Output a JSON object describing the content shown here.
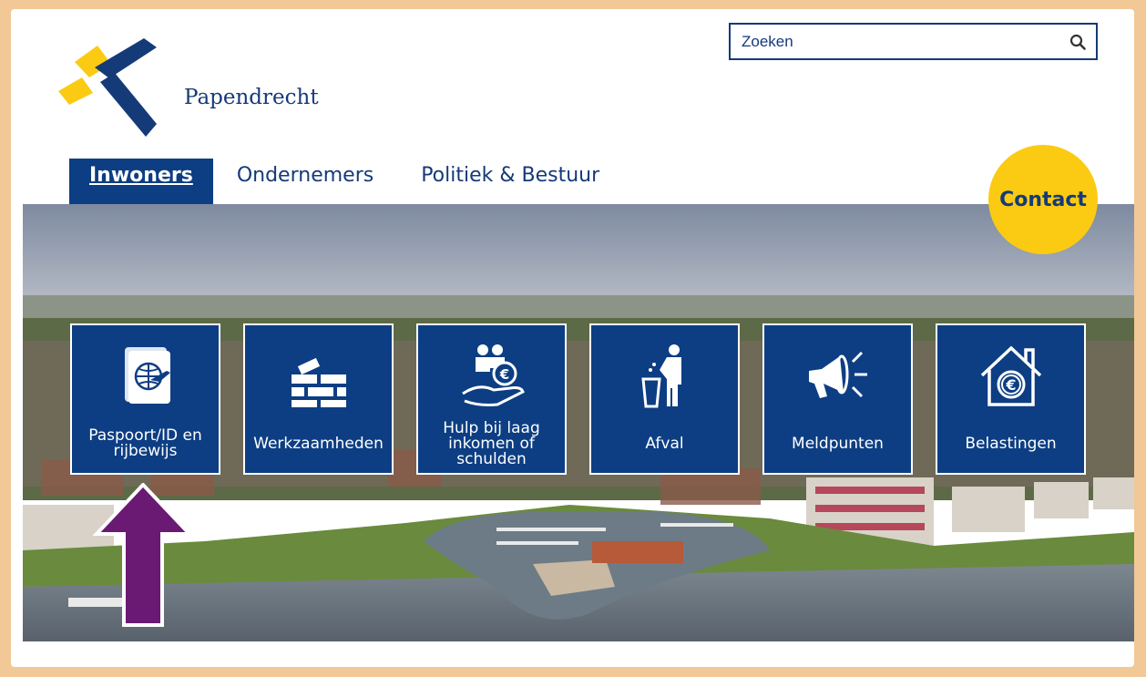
{
  "logo": {
    "name": "Papendrecht"
  },
  "search": {
    "placeholder": "Zoeken",
    "icon": "search-icon"
  },
  "nav": {
    "tabs": [
      {
        "label": "Inwoners",
        "active": true
      },
      {
        "label": "Ondernemers",
        "active": false
      },
      {
        "label": "Politiek & Bestuur",
        "active": false
      }
    ]
  },
  "contact": {
    "label": "Contact"
  },
  "tiles": [
    {
      "label": "Paspoort/ID en rijbewijs",
      "icon": "passport-icon"
    },
    {
      "label": "Werkzaamheden",
      "icon": "construction-icon"
    },
    {
      "label": "Hulp bij laag inkomen of schulden",
      "icon": "financial-help-icon"
    },
    {
      "label": "Afval",
      "icon": "waste-icon"
    },
    {
      "label": "Meldpunten",
      "icon": "megaphone-icon"
    },
    {
      "label": "Belastingen",
      "icon": "tax-house-icon"
    }
  ],
  "colors": {
    "brand_blue": "#0d3e83",
    "logo_blue": "#153a78",
    "contact_yellow": "#fbcb13",
    "frame": "#f1c896",
    "annotation_arrow": "#6a1a72"
  }
}
